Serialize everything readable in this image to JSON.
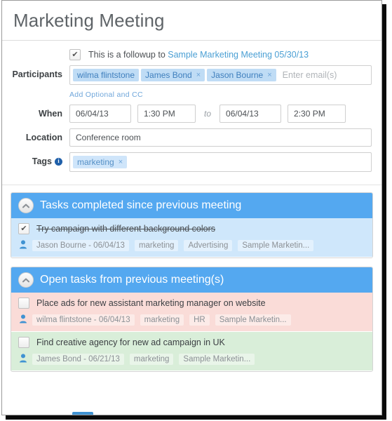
{
  "window": {
    "title": "Marketing Meeting"
  },
  "form": {
    "followup": {
      "checked": true,
      "checkmark": "✔",
      "text_prefix": "This is a followup to",
      "link_text": "Sample Marketing Meeting 05/30/13"
    },
    "participants": {
      "label": "Participants",
      "tokens": [
        {
          "name": "wilma flintstone",
          "removable": false,
          "remove_glyph": ""
        },
        {
          "name": "James Bond",
          "removable": true,
          "remove_glyph": "×"
        },
        {
          "name": "Jason Bourne",
          "removable": true,
          "remove_glyph": "×"
        }
      ],
      "placeholder": "Enter email(s)",
      "add_link": "Add Optional and CC"
    },
    "when": {
      "label": "When",
      "start_date": "06/04/13",
      "start_time": "1:30 PM",
      "separator": "to",
      "end_date": "06/04/13",
      "end_time": "2:30 PM"
    },
    "location": {
      "label": "Location",
      "value": "Conference room"
    },
    "tags": {
      "label": "Tags",
      "info_glyph": "i",
      "tokens": [
        {
          "name": "marketing",
          "remove_glyph": "×"
        }
      ]
    }
  },
  "panels": [
    {
      "id": "completed",
      "title": "Tasks completed since previous meeting",
      "icon": "chevron-up-circle-icon",
      "header_color": "#54a8f0",
      "tasks": [
        {
          "bg": "blue",
          "checked": true,
          "checkmark": "✔",
          "text": "Try campaign with different background colors",
          "done": true,
          "owner": "Jason Bourne - 06/04/13",
          "tags": [
            "marketing",
            "Advertising",
            "Sample Marketin..."
          ]
        }
      ]
    },
    {
      "id": "open",
      "title": "Open tasks from previous meeting(s)",
      "icon": "chevron-up-circle-icon",
      "header_color": "#54a8f0",
      "tasks": [
        {
          "bg": "pink",
          "checked": false,
          "checkmark": "",
          "text": "Place ads for new assistant marketing manager on website",
          "done": false,
          "owner": "wilma flintstone - 06/04/13",
          "tags": [
            "marketing",
            "HR",
            "Sample Marketin..."
          ]
        },
        {
          "bg": "green",
          "checked": false,
          "checkmark": "",
          "text": "Find creative agency for new ad campaign in UK",
          "done": false,
          "owner": "James Bond - 06/21/13",
          "tags": [
            "marketing",
            "Sample Marketin..."
          ]
        }
      ]
    }
  ],
  "colors": {
    "accent_blue": "#54a8f0",
    "link_blue": "#4a9fd4",
    "token_blue": "#bfdcf5",
    "task_blue": "#cfe7fb",
    "task_pink": "#fadcd8",
    "task_green": "#d9eed9"
  }
}
